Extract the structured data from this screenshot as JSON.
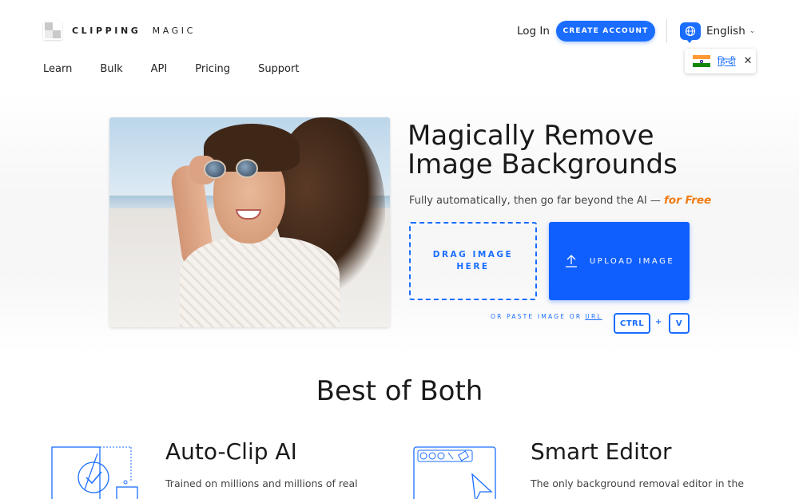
{
  "header": {
    "logo_bold": "CLIPPING",
    "logo_light": "MAGIC",
    "nav": [
      "Learn",
      "Bulk",
      "API",
      "Pricing",
      "Support"
    ],
    "login_label": "Log In",
    "create_account_label": "CREATE ACCOUNT",
    "language_label": "English",
    "language_icon": "globe-icon",
    "suggested_language": "हिन्दी",
    "accent_color": "#1a6dff"
  },
  "hero": {
    "title_line1": "Magically Remove",
    "title_line2": "Image Backgrounds",
    "subtitle": "Fully automatically, then go far beyond the AI —",
    "subtitle_free": "for Free",
    "free_color": "#f07c12",
    "drag_label": "DRAG IMAGE HERE",
    "upload_label": "UPLOAD IMAGE",
    "paste_text": "OR PASTE IMAGE OR",
    "paste_url": "URL",
    "key_ctrl": "CTRL",
    "key_plus": "+",
    "key_v": "V"
  },
  "features": {
    "heading": "Best of Both",
    "items": [
      {
        "title": "Auto-Clip AI",
        "description": "Trained on millions and millions of real",
        "icon": "ai-check-icon"
      },
      {
        "title": "Smart Editor",
        "description": "The only background removal editor in the",
        "icon": "editor-cursor-icon"
      }
    ]
  }
}
